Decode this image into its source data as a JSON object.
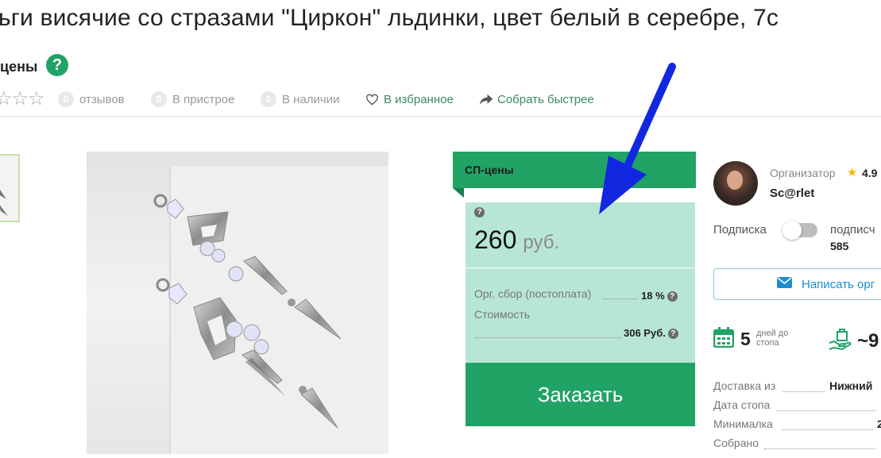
{
  "page": {
    "title": "ьги висячие со стразами \"Циркон\" льдинки, цвет белый в серебре, 7с",
    "subtitle": "цены",
    "help_glyph": "?"
  },
  "meta": {
    "stars": "☆☆☆",
    "reviews_count": "0",
    "reviews_label": "отзывов",
    "in_attach_count": "0",
    "in_attach_label": "В пристрое",
    "in_stock_count": "0",
    "in_stock_label": "В наличии",
    "favorites_label": "В избранное",
    "faster_label": "Собрать быстрее"
  },
  "price_panel": {
    "header": "СП-цены",
    "help_glyph": "?",
    "price_value": "260",
    "currency": "руб.",
    "org_fee_label": "Орг. сбор (постоплата)",
    "org_fee_value": "18 %",
    "cost_label": "Стоимость",
    "cost_value": "306 Руб.",
    "order_button": "Заказать"
  },
  "organizer": {
    "label": "Организатор",
    "rating": "4.9",
    "name": "Sc@rlet",
    "subscription_label": "Подписка",
    "subscribers_label": "подписч",
    "subscribers_count": "585",
    "message_button": "Написать орг",
    "subscription_on": false
  },
  "stats": {
    "days_value": "5",
    "days_label_line1": "дней до",
    "days_label_line2": "стопа",
    "approx_value": "~9"
  },
  "details": [
    {
      "label": "Доставка из",
      "value": "Нижний"
    },
    {
      "label": "Дата стопа",
      "value": ""
    },
    {
      "label": "Минималка",
      "value": "2"
    },
    {
      "label": "Собрано",
      "value": ""
    }
  ],
  "icons": {
    "help": "question-circle-icon",
    "star": "star-icon",
    "heart": "heart-icon",
    "share": "share-arrow-icon",
    "mail": "mail-icon",
    "calendar": "calendar-icon",
    "hand": "hand-icon",
    "arrow": "blue-arrow-annotation"
  },
  "colors": {
    "brand_green": "#21a366",
    "price_panel_bg": "#b8e6d4",
    "link_green": "#3b8a5c",
    "message_blue": "#1a8ed0",
    "annotation_blue": "#1228e0"
  }
}
